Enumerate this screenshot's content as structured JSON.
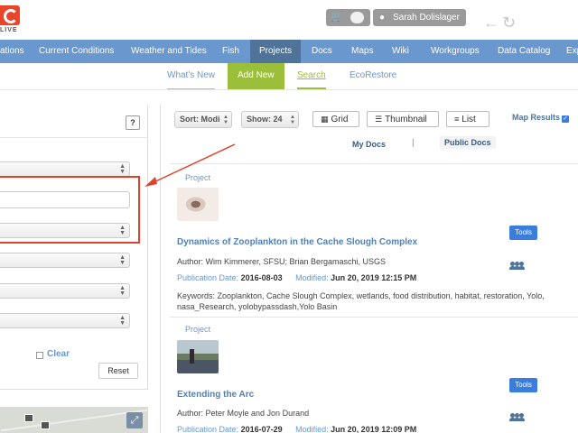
{
  "header": {
    "logo_text": "LIVE",
    "user_name": "Sarah Dolislager",
    "back_icon": "arrow-left-icon",
    "refresh_icon": "refresh-icon"
  },
  "main_nav": {
    "items": [
      "ations",
      "Current Conditions",
      "Weather and Tides",
      "Fish",
      "Projects",
      "Docs",
      "Maps",
      "Wiki",
      "Workgroups",
      "Data Catalog",
      "Exp"
    ],
    "active": "Projects"
  },
  "sub_nav": {
    "items": [
      "What's New",
      "Add New",
      "Search",
      "EcoRestore"
    ]
  },
  "left_panel": {
    "help_label": "?",
    "clear_label": "Clear",
    "reset_label": "Reset"
  },
  "toolbar": {
    "sort_label": "Sort: Modi",
    "show_label": "Show: 24",
    "grid_label": "Grid",
    "thumbnail_label": "Thumbnail",
    "list_label": "List",
    "map_results_label": "Map Results",
    "map_results_checked": true
  },
  "doc_tabs": {
    "my_docs": "My Docs",
    "separator": "|",
    "public_docs": "Public Docs"
  },
  "results": [
    {
      "type": "Project",
      "title": "Dynamics of Zooplankton in the Cache Slough Complex",
      "author": "Author: Wim Kimmerer, SFSU; Brian Bergamaschi, USGS",
      "publication_label": "Publication Date:",
      "publication_date": "2016-08-03",
      "modified_label": "Modified:",
      "modified_date": "Jun 20, 2019 12:15 PM",
      "keywords": "Keywords: Zooplankton, Cache Slough Complex, wetlands, food distribution, habitat, restoration, Yolo, nasa_Research, yolobypassdash,Yolo Basin",
      "tools_label": "Tools"
    },
    {
      "type": "Project",
      "title": "Extending the Arc",
      "author": "Author: Peter Moyle and Jon Durand",
      "publication_label": "Publication Date:",
      "publication_date": "2016-07-29",
      "modified_label": "Modified:",
      "modified_date": "Jun 20, 2019 12:09 PM",
      "tools_label": "Tools"
    }
  ],
  "colors": {
    "nav_bg": "#6a97cd",
    "nav_active": "#4f7399",
    "accent_green": "#9bbf3a",
    "annotation_red": "#e0412a",
    "tools_blue": "#3b7ddd"
  }
}
